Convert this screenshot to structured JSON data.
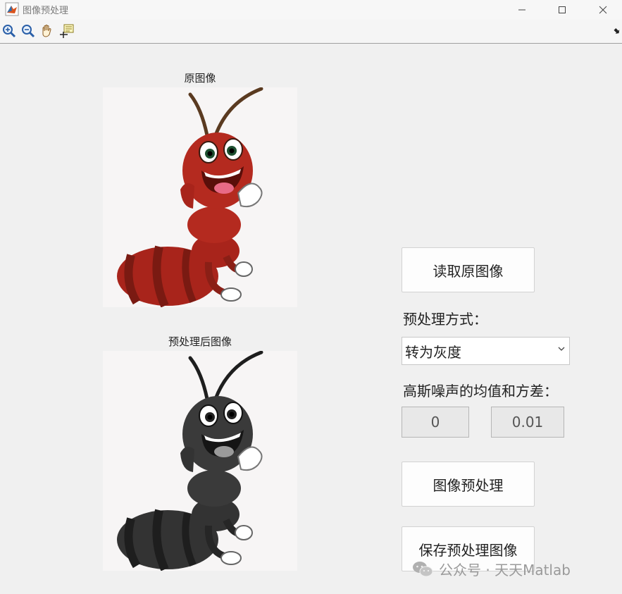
{
  "window": {
    "title": "图像预处理"
  },
  "toolbar": {
    "tools": [
      "zoom-in-icon",
      "zoom-out-icon",
      "pan-hand-icon",
      "data-cursor-icon"
    ]
  },
  "panels": {
    "original_label": "原图像",
    "processed_label": "预处理后图像"
  },
  "controls": {
    "read_button": "读取原图像",
    "method_label": "预处理方式：",
    "method_selected": "转为灰度",
    "noise_label": "高斯噪声的均值和方差：",
    "mean_value": "0",
    "variance_value": "0.01",
    "process_button": "图像预处理",
    "save_button": "保存预处理图像"
  },
  "watermark": {
    "text": "公众号 · 天天Matlab"
  },
  "colors": {
    "ant_original": "#a8241b",
    "ant_original_dark": "#7a1a12",
    "ant_gray": "#333333",
    "ant_gray_dark": "#1e1e1e"
  }
}
